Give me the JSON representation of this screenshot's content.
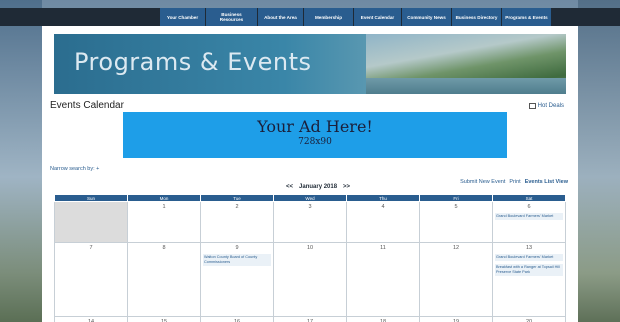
{
  "nav": {
    "items": [
      {
        "label": "Your Chamber"
      },
      {
        "label": "Business Resources"
      },
      {
        "label": "About the Area"
      },
      {
        "label": "Membership"
      },
      {
        "label": "Event Calendar"
      },
      {
        "label": "Community News"
      },
      {
        "label": "Business Directory"
      },
      {
        "label": "Programs & Events"
      }
    ]
  },
  "banner": {
    "title": "Programs & Events"
  },
  "page": {
    "title": "Events Calendar",
    "hot_deals": "Hot Deals",
    "narrow_search": "Narrow search by:  +"
  },
  "ad": {
    "line1": "Your Ad Here!",
    "line2": "728x90"
  },
  "calendar": {
    "prev": "<<",
    "month": "January 2018",
    "next": ">>",
    "links": {
      "submit": "Submit New Event",
      "print": "Print",
      "list": "Events List View"
    },
    "days": [
      "Sun",
      "Mon",
      "Tue",
      "Wed",
      "Thu",
      "Fri",
      "Sat"
    ],
    "weeks": [
      [
        {
          "date": "",
          "events": [],
          "empty": true
        },
        {
          "date": "1",
          "events": []
        },
        {
          "date": "2",
          "events": []
        },
        {
          "date": "3",
          "events": []
        },
        {
          "date": "4",
          "events": []
        },
        {
          "date": "5",
          "events": []
        },
        {
          "date": "6",
          "events": [
            "Grand Boulevard Farmers' Market"
          ]
        }
      ],
      [
        {
          "date": "7",
          "events": []
        },
        {
          "date": "8",
          "events": []
        },
        {
          "date": "9",
          "events": [
            "Walton County Board of County Commissioners"
          ]
        },
        {
          "date": "10",
          "events": []
        },
        {
          "date": "11",
          "events": []
        },
        {
          "date": "12",
          "events": []
        },
        {
          "date": "13",
          "events": [
            "Grand Boulevard Farmers' Market",
            "Breakfast with a Ranger at Topsail Hill Preserve State Park"
          ]
        }
      ],
      [
        {
          "date": "14",
          "events": []
        },
        {
          "date": "15",
          "events": []
        },
        {
          "date": "16",
          "events": []
        },
        {
          "date": "17",
          "events": []
        },
        {
          "date": "18",
          "events": []
        },
        {
          "date": "19",
          "events": []
        },
        {
          "date": "20",
          "events": []
        }
      ]
    ]
  }
}
